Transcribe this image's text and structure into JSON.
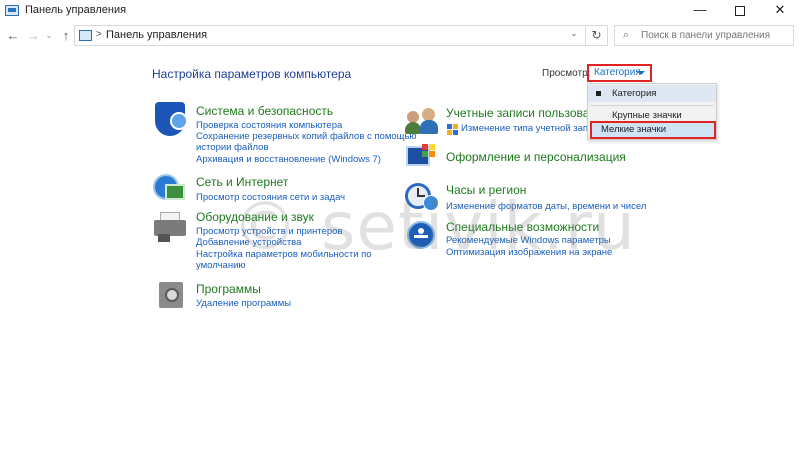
{
  "window": {
    "title": "Панель управления",
    "minimize": "—",
    "close": "✕"
  },
  "nav": {
    "back": "←",
    "forward": "→",
    "recent": "⌄",
    "up": "↑",
    "breadcrumb_sep": ">",
    "address": "Панель управления",
    "address_dropdown": "⌄",
    "refresh": "↻"
  },
  "search": {
    "icon": "⌕",
    "placeholder": "Поиск в панели управления"
  },
  "header": {
    "title": "Настройка параметров компьютера",
    "view_label": "Просмотр:",
    "view_value": "Категория"
  },
  "view_menu": {
    "items": [
      {
        "label": "Категория",
        "selected": true
      },
      {
        "label": "Крупные значки",
        "selected": false
      },
      {
        "label": "Мелкие значки",
        "selected": false,
        "highlighted": true
      }
    ]
  },
  "categories": [
    {
      "icon": "shield-icon",
      "title": "Система и безопасность",
      "links": [
        "Проверка состояния компьютера",
        "Сохранение резервных копий файлов с помощью",
        "истории файлов",
        "Архивация и восстановление (Windows 7)"
      ]
    },
    {
      "icon": "network-globe-icon",
      "title": "Сеть и Интернет",
      "links": [
        "Просмотр состояния сети и задач"
      ]
    },
    {
      "icon": "printer-icon",
      "title": "Оборудование и звук",
      "links": [
        "Просмотр устройств и принтеров",
        "Добавление устройства",
        "Настройка параметров мобильности по",
        "умолчанию"
      ]
    },
    {
      "icon": "programs-icon",
      "title": "Программы",
      "links": [
        "Удаление программы"
      ]
    },
    {
      "icon": "users-icon",
      "title": "Учетные записи пользоватe",
      "links": [
        "Изменение типа учетной записи"
      ]
    },
    {
      "icon": "appearance-icon",
      "title": "Оформление и персонализация",
      "links": []
    },
    {
      "icon": "clock-icon",
      "title": "Часы и регион",
      "links": [
        "Изменение форматов даты, времени и чисел"
      ]
    },
    {
      "icon": "accessibility-icon",
      "title": "Специальные возможности",
      "links": [
        "Рекомендуемые Windows параметры",
        "Оптимизация изображения на экране"
      ]
    }
  ],
  "watermark": "© setivik.ru",
  "colors": {
    "category_title": "#1e7a1e",
    "link": "#1a5fbf",
    "header": "#1f3f96",
    "highlight_border": "#e02424"
  }
}
